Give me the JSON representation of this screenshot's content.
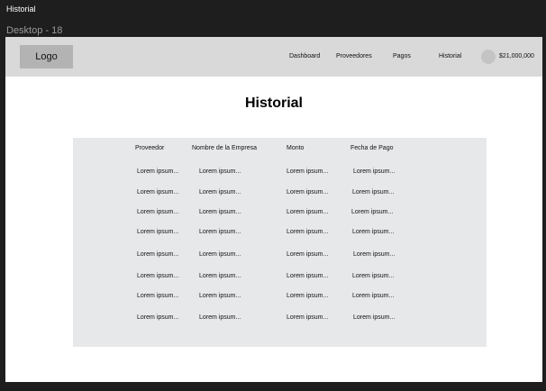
{
  "window": {
    "tab_title": "Historial",
    "frame_label": "Desktop - 18"
  },
  "navbar": {
    "logo": "Logo",
    "items": [
      "Dashboard",
      "Proveedores",
      "Pagos",
      "Historial"
    ],
    "balance": "$21,000,000"
  },
  "main": {
    "title": "Historial",
    "table": {
      "columns": [
        "Proveedor",
        "Nombre de la Empresa",
        "Monto",
        "Fecha de Pago"
      ],
      "rows": [
        [
          "Lorem ipsum...",
          "Lorem ipsum...",
          "Lorem ipsum...",
          "Lorem ipsum..."
        ],
        [
          "Lorem ipsum...",
          "Lorem ipsum...",
          "Lorem ipsum...",
          "Lorem ipsum..."
        ],
        [
          "Lorem ipsum...",
          "Lorem ipsum...",
          "Lorem ipsum...",
          "Lorem ipsum..."
        ],
        [
          "Lorem ipsum...",
          "Lorem ipsum...",
          "Lorem ipsum...",
          "Lorem ipsum..."
        ],
        [
          "Lorem ipsum...",
          "Lorem ipsum...",
          "Lorem ipsum...",
          "Lorem ipsum..."
        ],
        [
          "Lorem ipsum...",
          "Lorem ipsum...",
          "Lorem ipsum...",
          "Lorem ipsum..."
        ],
        [
          "Lorem ipsum...",
          "Lorem ipsum...",
          "Lorem ipsum...",
          "Lorem ipsum..."
        ],
        [
          "Lorem ipsum...",
          "Lorem ipsum...",
          "Lorem ipsum...",
          "Lorem ipsum..."
        ]
      ]
    }
  }
}
